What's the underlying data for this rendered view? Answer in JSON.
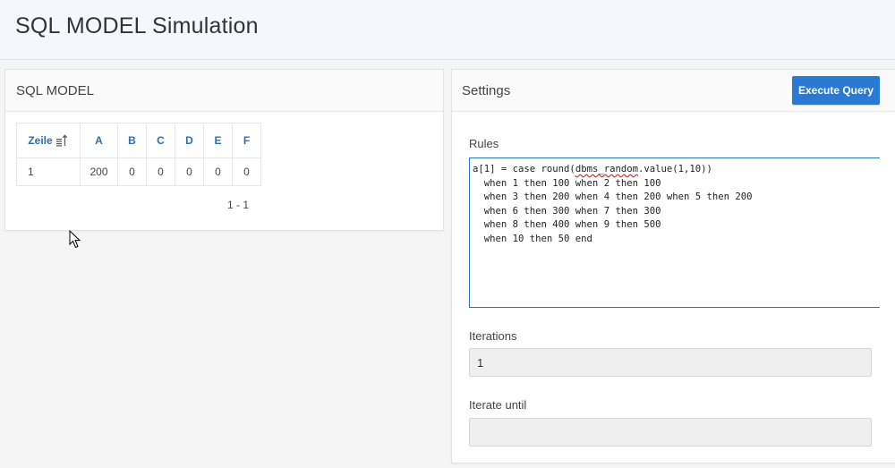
{
  "page": {
    "title": "SQL MODEL Simulation"
  },
  "left_region": {
    "title": "SQL MODEL",
    "table": {
      "headers": [
        "Zeile",
        "A",
        "B",
        "C",
        "D",
        "E",
        "F"
      ],
      "rows": [
        [
          "1",
          "200",
          "0",
          "0",
          "0",
          "0",
          "0"
        ]
      ],
      "sort_icon": "sort-ascending-icon"
    },
    "pagination": "1 - 1"
  },
  "right_region": {
    "title": "Settings",
    "execute_label": "Execute Query",
    "rules_label": "Rules",
    "rules_lines": [
      "a[1] = case round(",
      "dbms_random",
      ".value(1,10))",
      "  when 1 then 100 when 2 then 100",
      "  when 3 then 200 when 4 then 200 when 5 then 200",
      "  when 6 then 300 when 7 then 300",
      "  when 8 then 400 when 9 then 500",
      "  when 10 then 50 end"
    ],
    "iterations_label": "Iterations",
    "iterations_value": "1",
    "iterate_until_label": "Iterate until",
    "iterate_until_value": ""
  },
  "colors": {
    "accent": "#2a7ad3",
    "header_link": "#2d6db5",
    "topbar": "#f4f7fc"
  }
}
